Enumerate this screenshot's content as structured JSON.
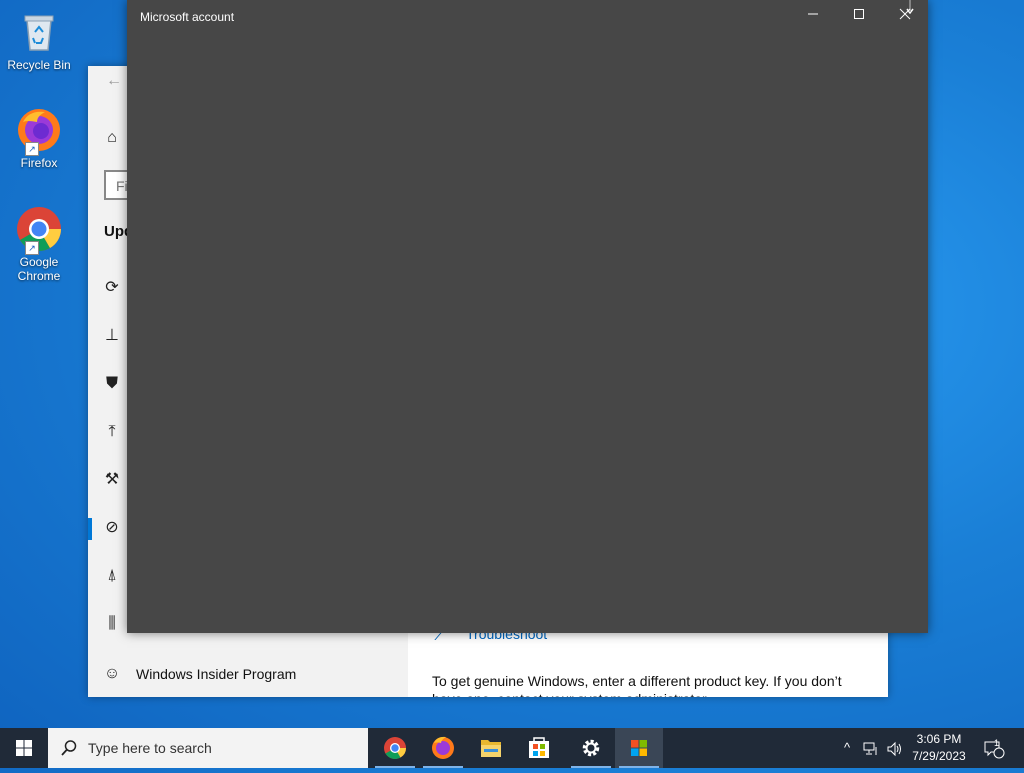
{
  "desktop": {
    "icons": [
      {
        "label": "Recycle Bin",
        "icon": "recycle-bin-icon"
      },
      {
        "label": "Firefox",
        "icon": "firefox-icon"
      },
      {
        "label": "Google Chrome",
        "icon": "chrome-icon"
      }
    ]
  },
  "settings_window": {
    "search_placeholder": "Fi",
    "heading": "Upd",
    "insider_label": "Windows Insider Program",
    "troubleshoot_link": "Troubleshoot",
    "genuine_text": "To get genuine Windows, enter a different product key. If you don’t have one, contact your system administrator.",
    "accent": "#0078d7"
  },
  "dialog": {
    "title": "Microsoft account",
    "background": "#474747"
  },
  "taskbar": {
    "search_placeholder": "Type here to search",
    "apps": [
      {
        "name": "Google Chrome",
        "icon": "chrome-icon",
        "running": true
      },
      {
        "name": "Firefox",
        "icon": "firefox-icon",
        "running": true
      },
      {
        "name": "File Explorer",
        "icon": "folder-icon",
        "running": false
      },
      {
        "name": "Microsoft Store",
        "icon": "store-icon",
        "running": false
      },
      {
        "name": "Settings",
        "icon": "gear-icon",
        "running": true
      },
      {
        "name": "Microsoft account",
        "icon": "microsoft-logo-icon",
        "running": true,
        "active": true
      }
    ],
    "time": "3:06 PM",
    "date": "7/29/2023",
    "notification_count": "1"
  }
}
